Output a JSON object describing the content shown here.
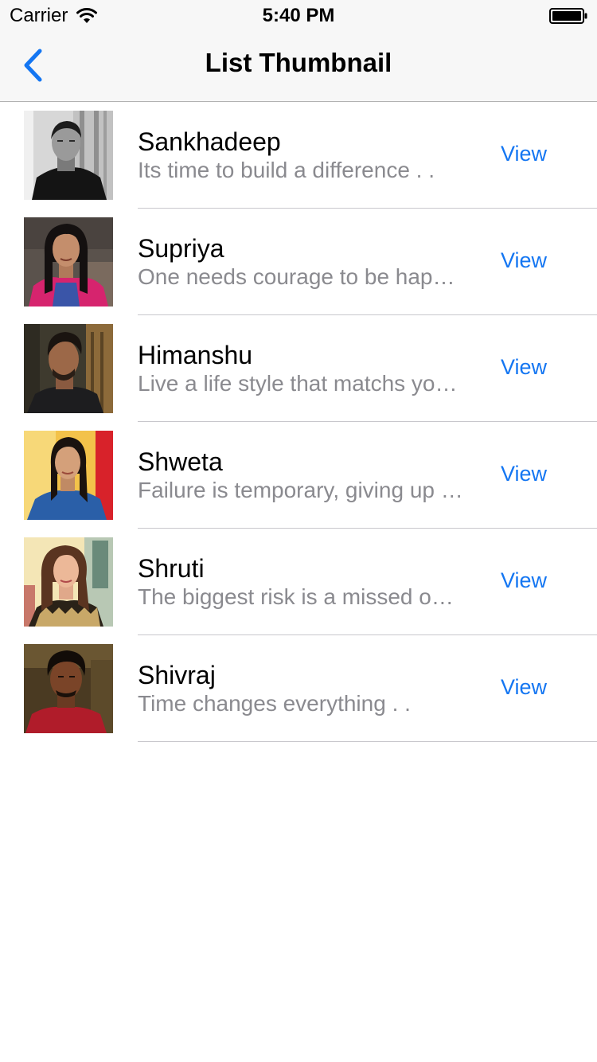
{
  "status_bar": {
    "carrier": "Carrier",
    "time": "5:40 PM"
  },
  "nav": {
    "title": "List Thumbnail",
    "back_icon": "chevron-left-icon"
  },
  "colors": {
    "accent": "#1476f2",
    "subtitle": "#8a8a8f",
    "separator": "#c8c7cc",
    "bar_background": "#f7f7f7"
  },
  "list": {
    "items": [
      {
        "name": "Sankhadeep",
        "subtitle": "Its time to build a difference . .",
        "action": "View"
      },
      {
        "name": "Supriya",
        "subtitle": "One needs courage to be happy and smile",
        "action": "View"
      },
      {
        "name": "Himanshu",
        "subtitle": "Live a life style that matchs your vision",
        "action": "View"
      },
      {
        "name": "Shweta",
        "subtitle": "Failure is temporary, giving up makes it permanent",
        "action": "View"
      },
      {
        "name": "Shruti",
        "subtitle": "The biggest risk is a missed opportunity",
        "action": "View"
      },
      {
        "name": "Shivraj",
        "subtitle": "Time changes everything . .",
        "action": "View"
      }
    ]
  }
}
